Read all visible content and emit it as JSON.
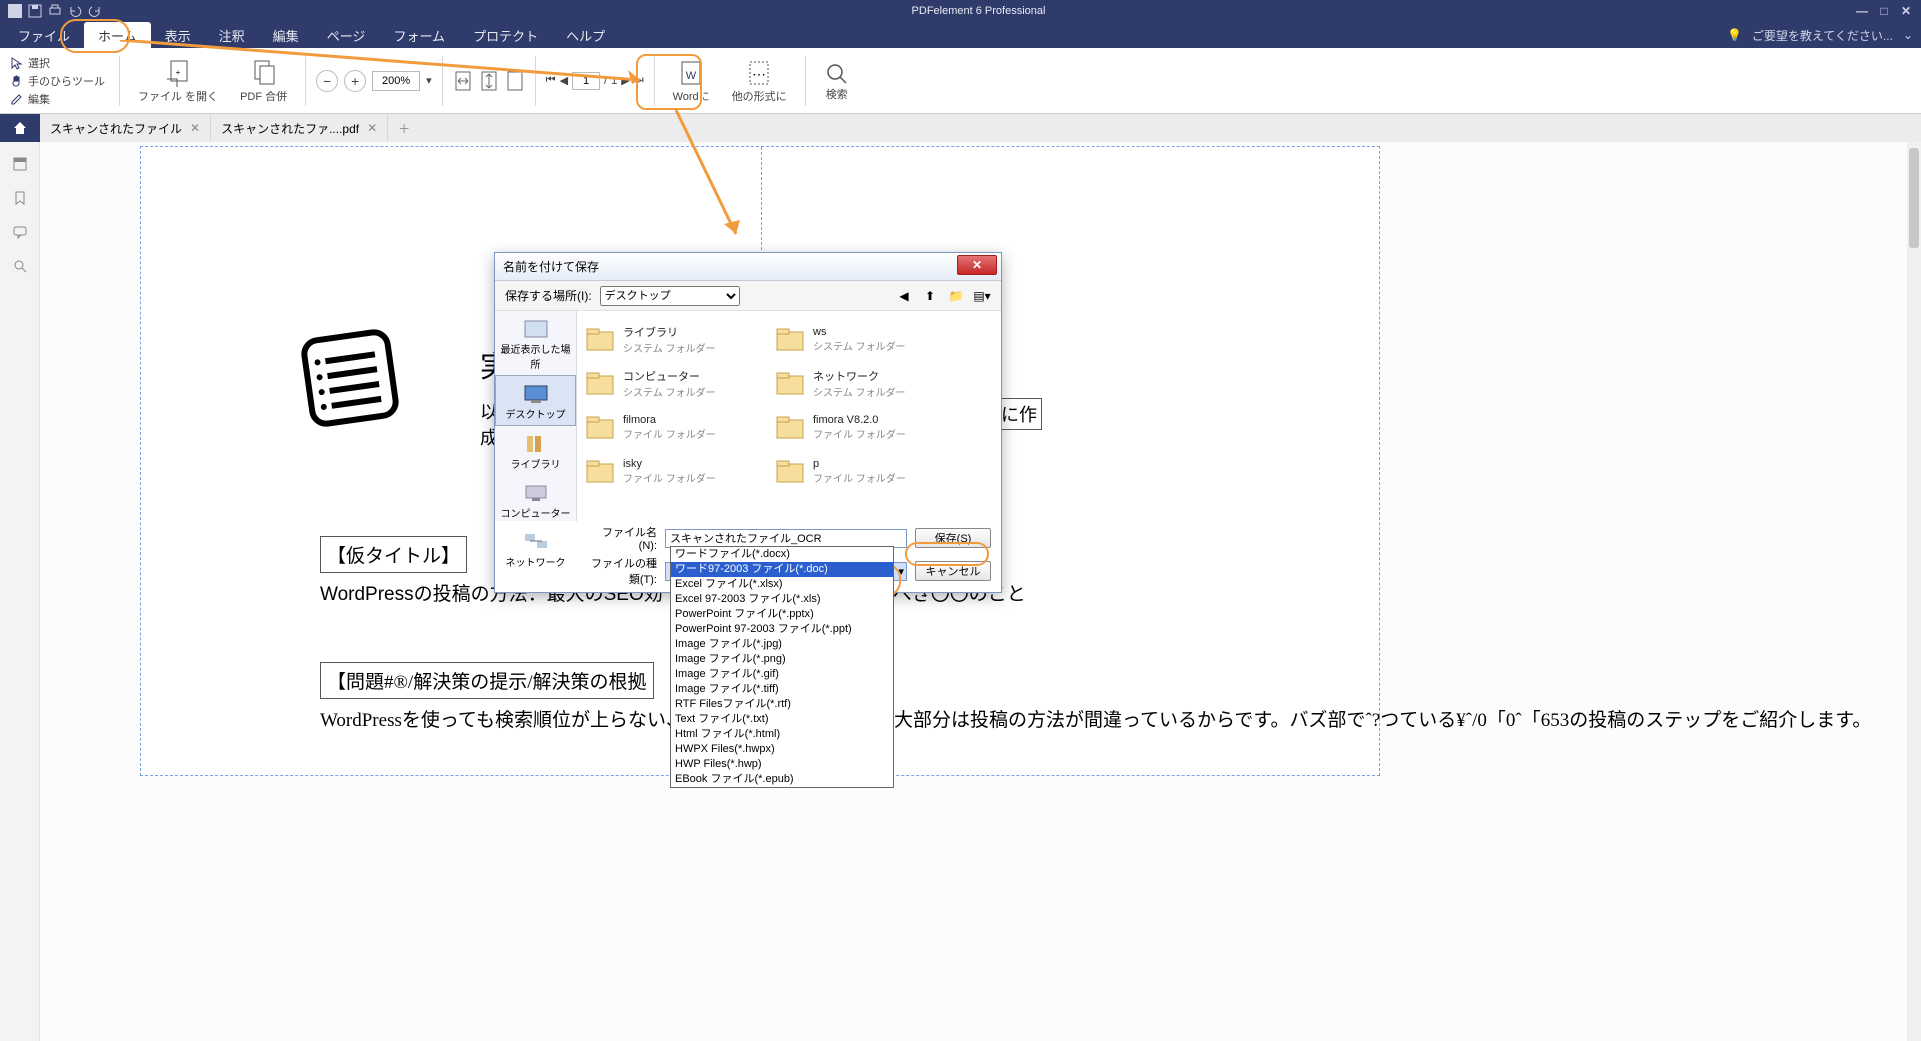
{
  "app_title": "PDFelement 6 Professional",
  "feedback_text": "ご要望を教えてください...",
  "menu": {
    "file": "ファイル",
    "home": "ホーム",
    "view": "表示",
    "annotate": "注釈",
    "edit": "編集",
    "page": "ページ",
    "form": "フォーム",
    "protect": "プロテクト",
    "help": "ヘルプ"
  },
  "tools": {
    "select": "選択",
    "hand": "手のひらツール",
    "edit": "編集",
    "open_file": "ファイル\nを開く",
    "pdf_merge": "PDF\n合併",
    "to_word": "Wordに",
    "to_other": "他の形式に",
    "search": "検索"
  },
  "zoom": "200%",
  "page_cur": "1",
  "page_total": "1",
  "tabs": [
    {
      "label": "スキャンされたファイル"
    },
    {
      "label": "スキャンされたファ....pdf"
    }
  ],
  "doc": {
    "title_partial": "実",
    "line1a": "以",
    "line1b": "ぐ前に作",
    "line1c": "成",
    "box1": "【仮タイトル】",
    "para1": "WordPressの投稿の方法：最大のSEO効",
    "para1b": "べき〇〇のこと",
    "box2": "【問題#®/解決策の提示/解決策の根拠",
    "para2": "WordPressを使っても検索順位が上らない、、、だとしたらその理由の大部分は投稿の方法が間違っているからです。バズ部でˆ?つている¥ˆ/0「0ˆ「653の投稿のステップをご紹介します。"
  },
  "dialog": {
    "title": "名前を付けて保存",
    "save_in_label": "保存する場所(I):",
    "save_in_value": "デスクトップ",
    "places": [
      "最近表示した場所",
      "デスクトップ",
      "ライブラリ",
      "コンピューター",
      "ネットワーク"
    ],
    "items": [
      {
        "name": "ライブラリ",
        "type": "システム フォルダー"
      },
      {
        "name": "ws",
        "type": "システム フォルダー"
      },
      {
        "name": "コンピューター",
        "type": "システム フォルダー"
      },
      {
        "name": "ネットワーク",
        "type": "システム フォルダー"
      },
      {
        "name": "filmora",
        "type": "ファイル フォルダー"
      },
      {
        "name": "fimora V8.2.0",
        "type": "ファイル フォルダー"
      },
      {
        "name": "isky",
        "type": "ファイル フォルダー"
      },
      {
        "name": "p",
        "type": "ファイル フォルダー"
      }
    ],
    "filename_label": "ファイル名(N):",
    "filename_value": "スキャンされたファイル_OCR",
    "filetype_label": "ファイルの種類(T):",
    "filetype_value": "ワード97-2003 ファイル(*.doc)",
    "save_btn": "保存(S)",
    "cancel_btn": "キャンセル"
  },
  "filetypes": [
    "ワードファイル(*.docx)",
    "ワード97-2003 ファイル(*.doc)",
    "Excel ファイル(*.xlsx)",
    "Excel 97-2003 ファイル(*.xls)",
    "PowerPoint ファイル(*.pptx)",
    "PowerPoint 97-2003 ファイル(*.ppt)",
    "Image ファイル(*.jpg)",
    "Image ファイル(*.png)",
    "Image ファイル(*.gif)",
    "Image ファイル(*.tiff)",
    "RTF Filesファイル(*.rtf)",
    "Text ファイル(*.txt)",
    "Html ファイル(*.html)",
    "HWPX Files(*.hwpx)",
    "HWP Files(*.hwp)",
    "EBook ファイル(*.epub)"
  ]
}
